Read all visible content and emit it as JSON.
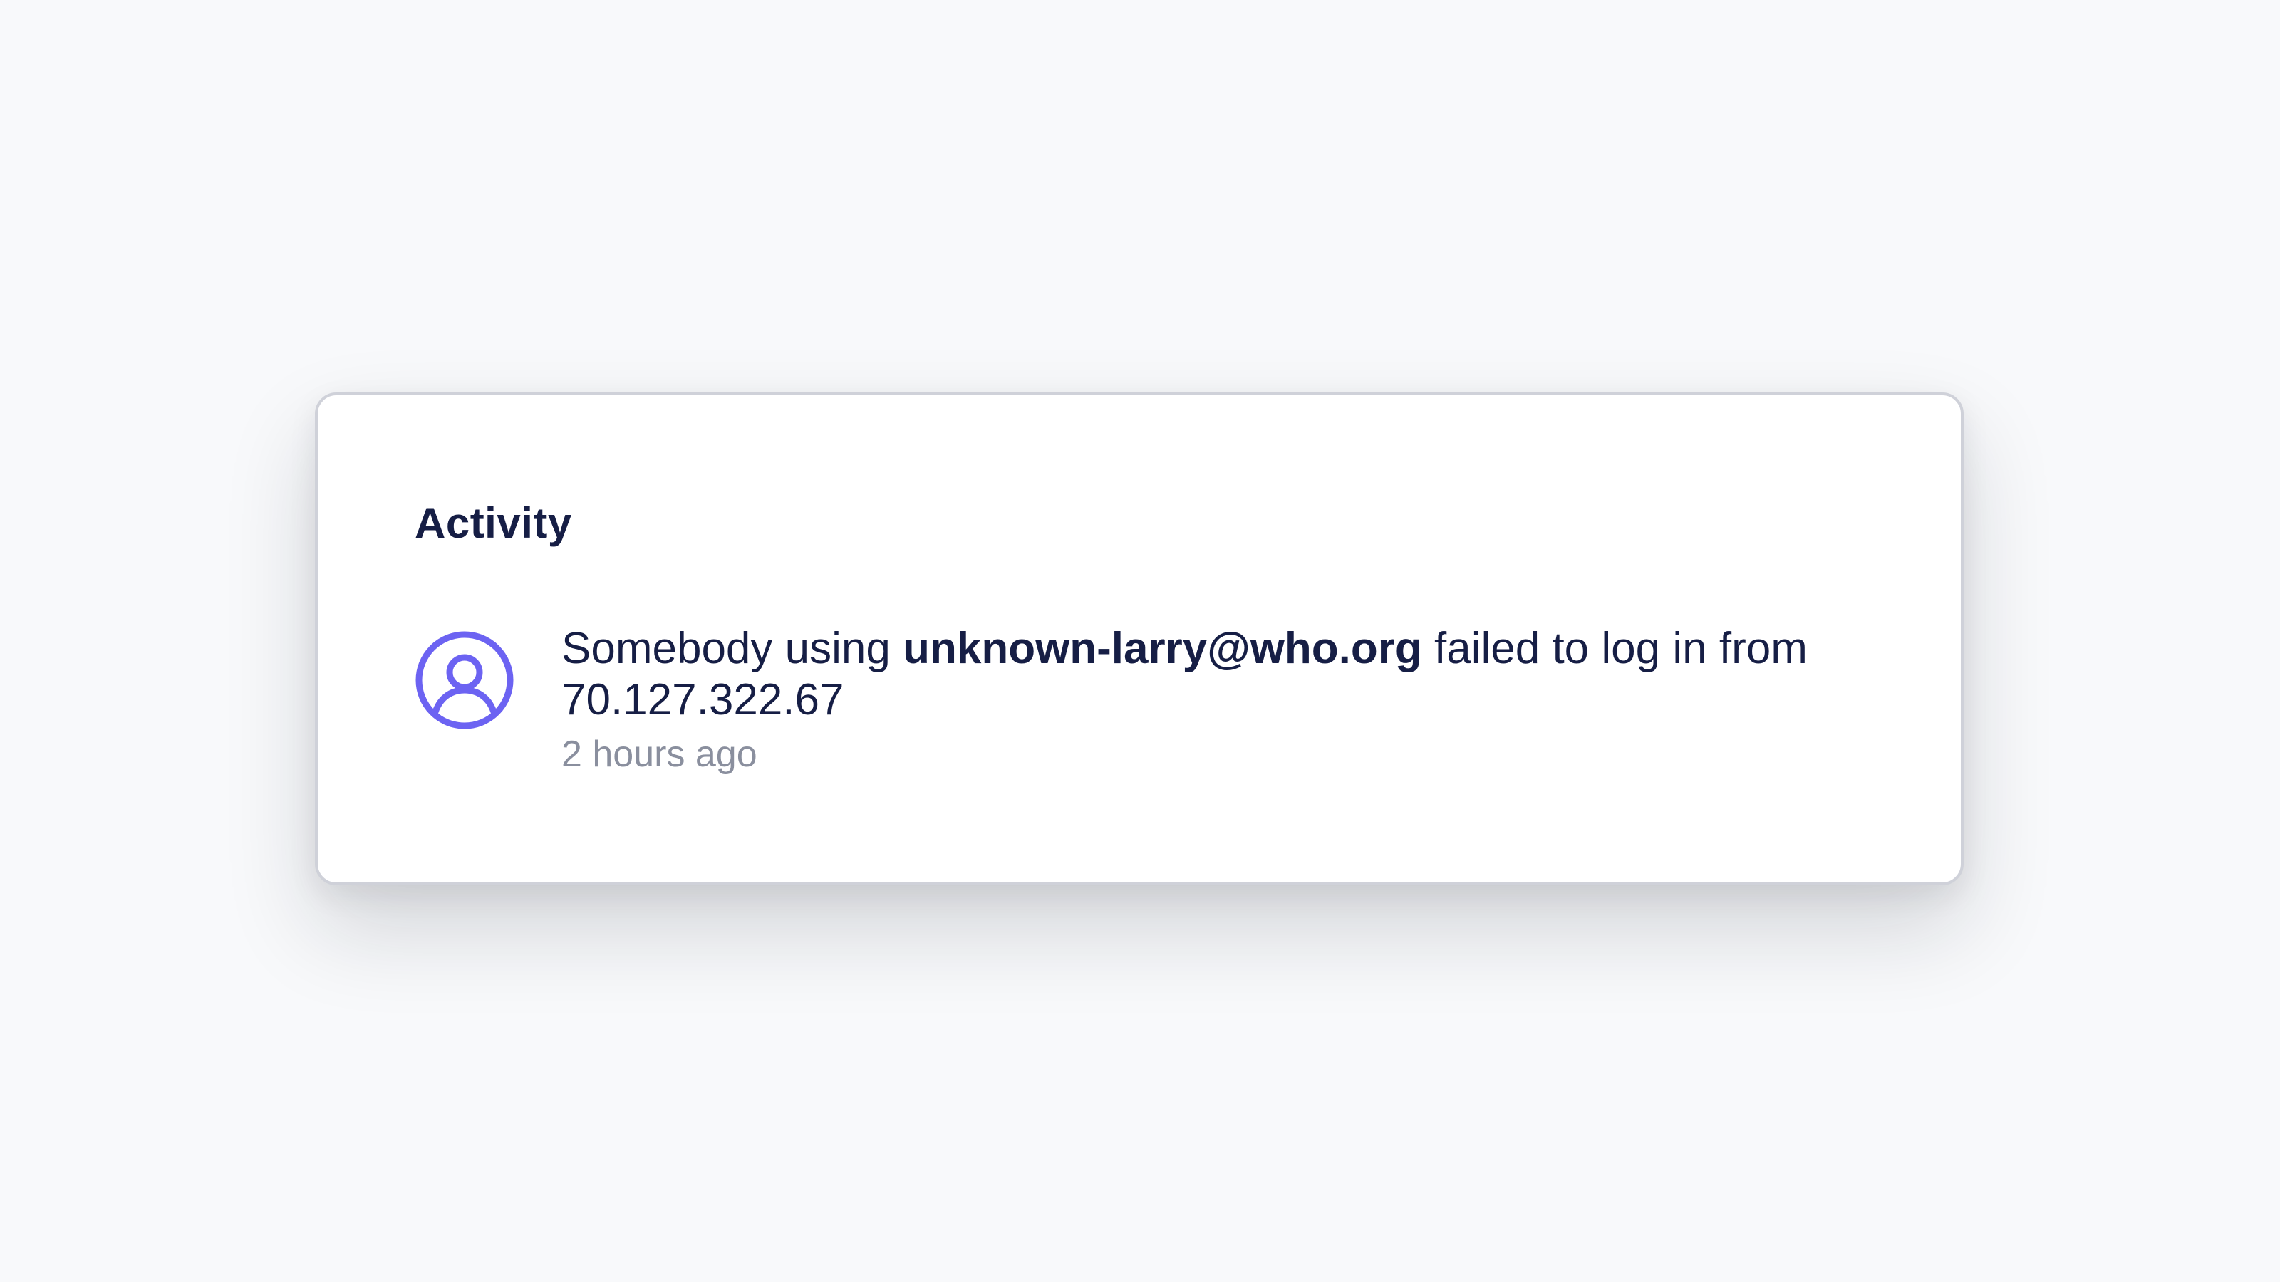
{
  "activity": {
    "title": "Activity",
    "items": [
      {
        "icon": "user-circle-icon",
        "message_prefix": "Somebody using",
        "email": "unknown-larry@who.org",
        "message_suffix": "failed to log in from",
        "ip": "70.127.322.67",
        "time": "2 hours ago"
      }
    ]
  },
  "colors": {
    "background": "#f8f9fb",
    "card": "#ffffff",
    "card_border": "#cfd1d9",
    "text": "#161e45",
    "muted_text": "#8a8f9e",
    "icon_accent": "#6c63f2"
  }
}
